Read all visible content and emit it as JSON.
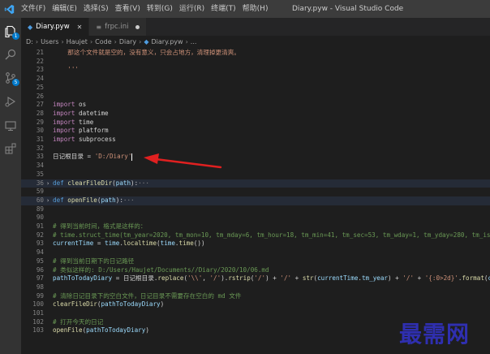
{
  "titlebar": {
    "menu": [
      "文件(F)",
      "编辑(E)",
      "选择(S)",
      "查看(V)",
      "转到(G)",
      "运行(R)",
      "终端(T)",
      "帮助(H)"
    ],
    "window_title": "Diary.pyw - Visual Studio Code"
  },
  "activitybar": {
    "explorer_badge": "1",
    "scm_badge": "5"
  },
  "tabs": [
    {
      "label": "Diary.pyw",
      "active": true
    },
    {
      "label": "frpc.ini",
      "active": false
    }
  ],
  "breadcrumb": {
    "parts": [
      "D:",
      "Users",
      "Haujet",
      "Code",
      "Diary",
      "Diary.pyw",
      "..."
    ]
  },
  "editor": {
    "lines": [
      {
        "n": "21",
        "t": "    那这个文件就是空的，没有意义，只会占地方，清理掉更清爽。"
      },
      {
        "n": "22",
        "t": ""
      },
      {
        "n": "23",
        "t": "    '''"
      },
      {
        "n": "24",
        "t": ""
      },
      {
        "n": "25",
        "t": ""
      },
      {
        "n": "26",
        "t": ""
      },
      {
        "n": "27",
        "t": "import os"
      },
      {
        "n": "28",
        "t": "import datetime"
      },
      {
        "n": "29",
        "t": "import time"
      },
      {
        "n": "30",
        "t": "import platform"
      },
      {
        "n": "31",
        "t": "import subprocess"
      },
      {
        "n": "32",
        "t": ""
      },
      {
        "n": "33",
        "t": "日记根目录 = 'D:/Diary'"
      },
      {
        "n": "34",
        "t": ""
      },
      {
        "n": "35",
        "t": ""
      },
      {
        "n": "36",
        "t": "def clearFileDir(path):···"
      },
      {
        "n": "59",
        "t": ""
      },
      {
        "n": "60",
        "t": "def openFile(path):···"
      },
      {
        "n": "89",
        "t": ""
      },
      {
        "n": "90",
        "t": ""
      },
      {
        "n": "91",
        "t": "# 得到当前时间，格式是这样的："
      },
      {
        "n": "92",
        "t": "# time.struct_time(tm_year=2020, tm_mon=10, tm_mday=6, tm_hour=18, tm_min=41, tm_sec=53, tm_wday=1, tm_yday=280, tm_isdst"
      },
      {
        "n": "93",
        "t": "currentTime = time.localtime(time.time())"
      },
      {
        "n": "94",
        "t": ""
      },
      {
        "n": "95",
        "t": "# 得到当前日期下的日记路径"
      },
      {
        "n": "96",
        "t": "# 类似这样的: D:/Users/Haujet/Documents//Diary/2020/10/06.md"
      },
      {
        "n": "97",
        "t": "pathToTodayDiary = 日记根目录.replace('\\\\', '/').rstrip('/') + '/' + str(currentTime.tm_year) + '/' + '{:0>2d}'.format(curr"
      },
      {
        "n": "98",
        "t": ""
      },
      {
        "n": "99",
        "t": "# 清除日记目录下的空白文件，日记目录不需要存在空白的 md 文件"
      },
      {
        "n": "100",
        "t": "clearFileDir(pathToTodayDiary)"
      },
      {
        "n": "101",
        "t": ""
      },
      {
        "n": "102",
        "t": "# 打开今天的日记"
      },
      {
        "n": "103",
        "t": "openFile(pathToTodayDiary)"
      }
    ]
  },
  "watermark": "最需网",
  "colors": {
    "keyword": "#c586c0",
    "string": "#ce9178",
    "comment": "#6a9955",
    "function": "#dcdcaa",
    "annotation_arrow": "#e02020"
  }
}
